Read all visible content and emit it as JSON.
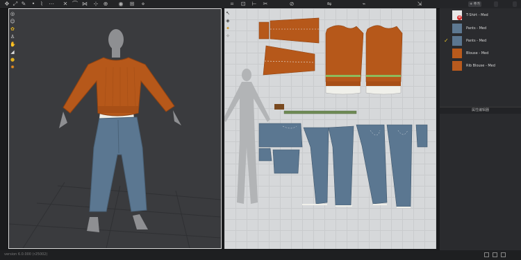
{
  "toolbar": {
    "icons": [
      "move-icon",
      "transform-icon",
      "edit-icon",
      "point-icon",
      "sew-icon",
      "stitch-icon",
      "pin-icon",
      "tuck-icon",
      "fold-icon",
      "avatar-icon",
      "simulate-icon",
      "grid-icon",
      "render-icon",
      "select-icon",
      "pattern-icon",
      "segment-icon",
      "trace-icon",
      "sewing-icon",
      "fold-line-icon",
      "button-icon",
      "zipper-icon",
      "texture-icon"
    ]
  },
  "viewport3d": {
    "tools": [
      "cursor-icon",
      "avatar-icon",
      "texture-icon",
      "person-icon",
      "hand-icon",
      "measure-icon",
      "light-icon",
      "render-icon"
    ]
  },
  "viewport2d": {
    "tools": [
      "cursor-icon",
      "transform-icon",
      "pattern-icon",
      "star-icon"
    ]
  },
  "object_panel": {
    "add_label": "+ 추가",
    "btn_a": "",
    "btn_b": "",
    "fabrics": [
      {
        "name": "T-Shirt - Med",
        "color": "#e9e9e9",
        "checked": false
      },
      {
        "name": "Pants - Med",
        "color": "#5d7891",
        "checked": false
      },
      {
        "name": "Pants - Med",
        "color": "#5b7690",
        "checked": true
      },
      {
        "name": "Blouse - Med",
        "color": "#b95a1c",
        "checked": false
      },
      {
        "name": "Rib Blouse - Med",
        "color": "#b85a1e",
        "checked": false
      }
    ],
    "property_editor_label": "属性编辑器"
  },
  "status": {
    "text": "version 6.0.000 (r25002)",
    "icons": [
      "layout-icon",
      "window-icon",
      "fullscreen-icon"
    ]
  },
  "colors": {
    "sweater": "#b6581a",
    "jeans": "#5b7791",
    "shirt": "#f0f0ea",
    "avatar": "#8e8f92"
  }
}
